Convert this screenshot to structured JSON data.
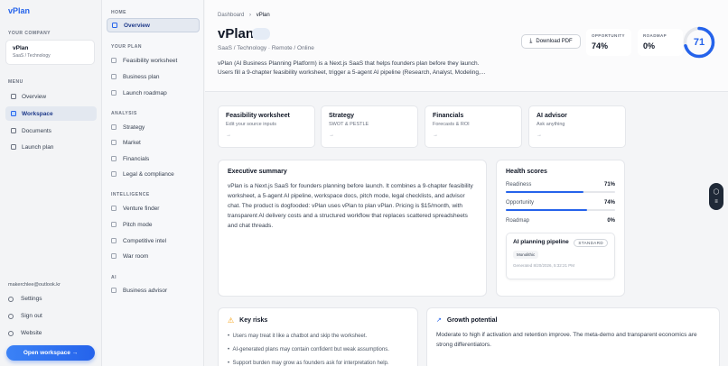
{
  "sidebar": {
    "brand": "vPlan",
    "company_section": "YOUR COMPANY",
    "company_name": "vPlan",
    "company_sub": "SaaS / Technology",
    "menu_section": "MENU",
    "menu": [
      {
        "label": "Overview"
      },
      {
        "label": "Workspace"
      },
      {
        "label": "Documents"
      },
      {
        "label": "Launch plan"
      }
    ],
    "user_email": "makerchlee@outlook.kr",
    "footer": [
      {
        "label": "Settings"
      },
      {
        "label": "Sign out"
      },
      {
        "label": "Website"
      }
    ],
    "open_button": "Open workspace  →"
  },
  "nav2": {
    "home_section": "HOME",
    "overview": "Overview",
    "plan_section": "YOUR PLAN",
    "plan": [
      "Feasibility worksheet",
      "Business plan",
      "Launch roadmap"
    ],
    "analysis_section": "ANALYSIS",
    "analysis": [
      "Strategy",
      "Market",
      "Financials",
      "Legal & compliance"
    ],
    "intel_section": "INTELLIGENCE",
    "intel": [
      "Venture finder",
      "Pitch mode",
      "Competitive intel",
      "War room"
    ],
    "ai_section": "AI",
    "ai": [
      "Business advisor"
    ]
  },
  "header": {
    "crumb_root": "Dashboard",
    "crumb_sep": "›",
    "crumb_current": "vPlan",
    "title": "vPlan",
    "subtitle": "SaaS / Technology · Remote / Online",
    "desc1": "vPlan (AI Business Planning Platform) is a Next.js SaaS that helps founders plan before they launch.",
    "desc2": "Users fill a 9-chapter feasibility worksheet, trigger a 5-agent AI pipeline (Research, Analyst, Modeling,...",
    "pdf_label": "Download PDF",
    "opportunity_label": "OPPORTUNITY",
    "opportunity_value": "74%",
    "roadmap_label": "ROADMAP",
    "roadmap_value": "0%",
    "score": "71",
    "score_fraction": 0.71
  },
  "quick": [
    {
      "title": "Feasibility worksheet",
      "sub": "Edit your source inputs",
      "arrow": "→"
    },
    {
      "title": "Strategy",
      "sub": "SWOT & PESTLE",
      "arrow": "→"
    },
    {
      "title": "Financials",
      "sub": "Forecasts & ROI",
      "arrow": "→"
    },
    {
      "title": "AI advisor",
      "sub": "Ask anything",
      "arrow": "→"
    }
  ],
  "summary": {
    "title": "Executive summary",
    "body": "vPlan is a Next.js SaaS for founders planning before launch. It combines a 9-chapter feasibility worksheet, a 5-agent AI pipeline, workspace docs, pitch mode, legal checklists, and advisor chat. The product is dogfooded: vPlan uses vPlan to plan vPlan. Pricing is $15/month, with transparent AI delivery costs and a structured workflow that replaces scattered spreadsheets and chat threads."
  },
  "health": {
    "title": "Health scores",
    "rows": [
      {
        "label": "Readiness",
        "pct": "71%",
        "value": 0.71
      },
      {
        "label": "Opportunity",
        "pct": "74%",
        "value": 0.74
      },
      {
        "label": "Roadmap",
        "pct": "0%",
        "value": 0
      }
    ],
    "pipeline_title": "AI planning pipeline",
    "pipeline_badge": "STANDARD",
    "pipeline_chip": "Monolithic",
    "pipeline_date": "Generated 8/20/2026, 5:32:21 PM"
  },
  "risks": {
    "title": "Key risks",
    "items": [
      "Users may treat it like a chatbot and skip the worksheet.",
      "AI-generated plans may contain confident but weak assumptions.",
      "Support burden may grow as founders ask for interpretation help."
    ]
  },
  "growth": {
    "title": "Growth potential",
    "body": "Moderate to high if activation and retention improve. The meta-demo and transparent economics are strong differentiators."
  },
  "colors": {
    "accent": "#2563eb",
    "warning": "#f59e0b"
  }
}
